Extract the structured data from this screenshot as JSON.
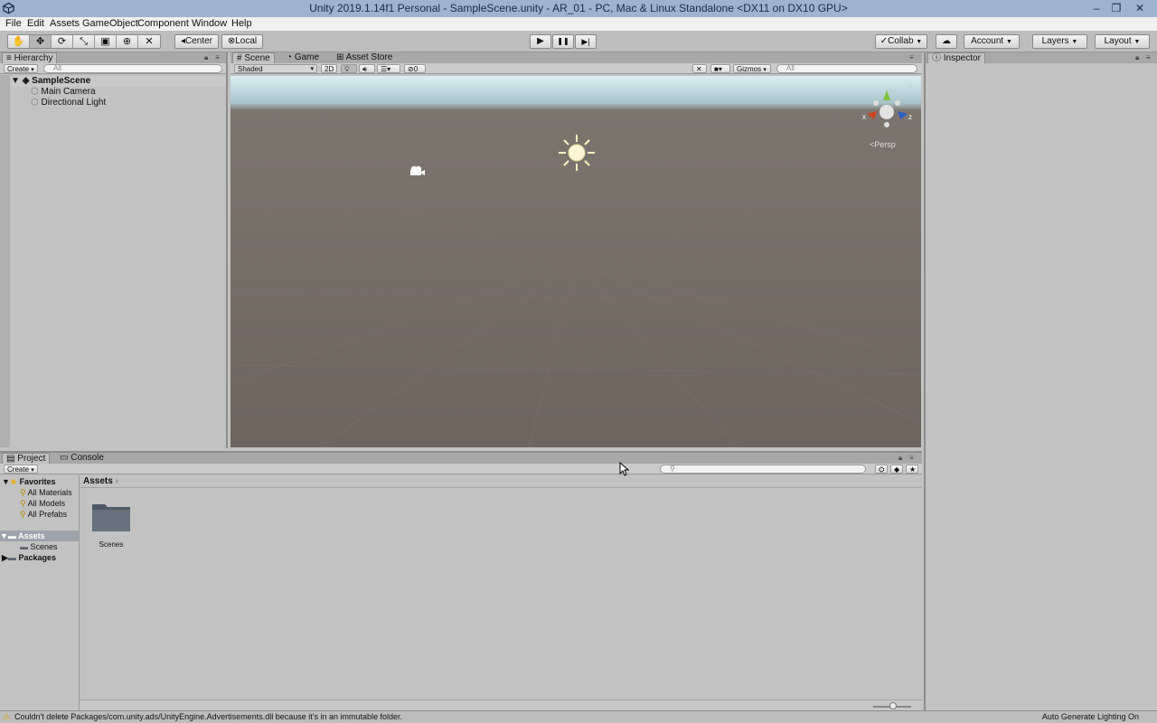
{
  "window": {
    "title": "Unity 2019.1.14f1 Personal - SampleScene.unity - AR_01 - PC, Mac & Linux Standalone <DX11 on DX10 GPU>",
    "controls": [
      "–",
      "❐",
      "✕"
    ]
  },
  "menu": [
    "File",
    "Edit",
    "Assets",
    "GameObject",
    "Component",
    "Window",
    "Help"
  ],
  "toolbar": {
    "tools": [
      "hand-tool",
      "move-tool",
      "rotate-tool",
      "scale-tool",
      "rect-tool",
      "transform-tool",
      "custom-tool"
    ],
    "pivot_center": "Center",
    "pivot_local": "Local",
    "play": "▶",
    "pause": "❚❚",
    "step": "▶|",
    "collab": "Collab",
    "account": "Account",
    "layers": "Layers",
    "layout": "Layout"
  },
  "hierarchy": {
    "tab": "Hierarchy",
    "create": "Create",
    "search_placeholder": "All",
    "scene_name": "SampleScene",
    "items": [
      "Main Camera",
      "Directional Light"
    ]
  },
  "scene": {
    "tabs": [
      "Scene",
      "Game",
      "Asset Store"
    ],
    "shading": "Shaded",
    "mode_2d": "2D",
    "hidden_count": "0",
    "gizmos": "Gizmos",
    "search_placeholder": "All",
    "persp": "Persp",
    "axis_x": "x",
    "axis_z": "z"
  },
  "inspector": {
    "tab": "Inspector"
  },
  "project": {
    "tabs": [
      "Project",
      "Console"
    ],
    "create": "Create",
    "favorites_label": "Favorites",
    "favorites": [
      "All Materials",
      "All Models",
      "All Prefabs"
    ],
    "assets_label": "Assets",
    "assets_children": [
      "Scenes"
    ],
    "packages_label": "Packages",
    "breadcrumb": "Assets",
    "folder_items": [
      "Scenes"
    ]
  },
  "statusbar": {
    "message": "Couldn't delete Packages/com.unity.ads/UnityEngine.Advertisements.dll because it's in an immutable folder.",
    "right_text": "Auto Generate Lighting On"
  }
}
